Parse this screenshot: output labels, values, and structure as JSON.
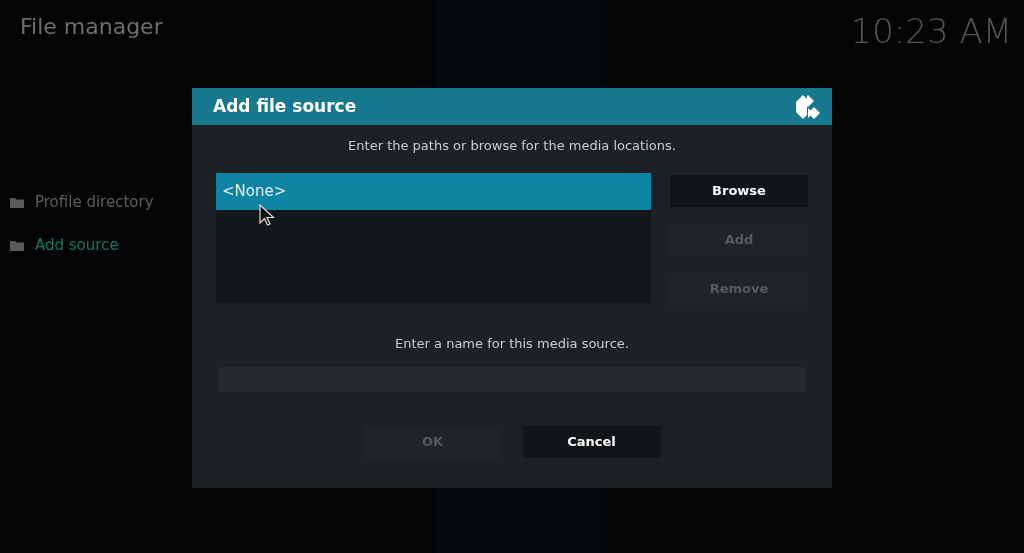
{
  "header": {
    "title": "File manager",
    "clock": "10:23 AM"
  },
  "sidebar": {
    "items": [
      {
        "label": "Profile directory",
        "selected": false
      },
      {
        "label": "Add source",
        "selected": true
      }
    ]
  },
  "dialog": {
    "title": "Add file source",
    "paths_prompt": "Enter the paths or browse for the media locations.",
    "paths": [
      {
        "label": "<None>",
        "selected": true
      }
    ],
    "side_buttons": [
      {
        "label": "Browse",
        "disabled": false
      },
      {
        "label": "Add",
        "disabled": true
      },
      {
        "label": "Remove",
        "disabled": true
      }
    ],
    "name_prompt": "Enter a name for this media source.",
    "buttons": [
      {
        "label": "OK",
        "disabled": true
      },
      {
        "label": "Cancel",
        "disabled": false
      }
    ]
  }
}
